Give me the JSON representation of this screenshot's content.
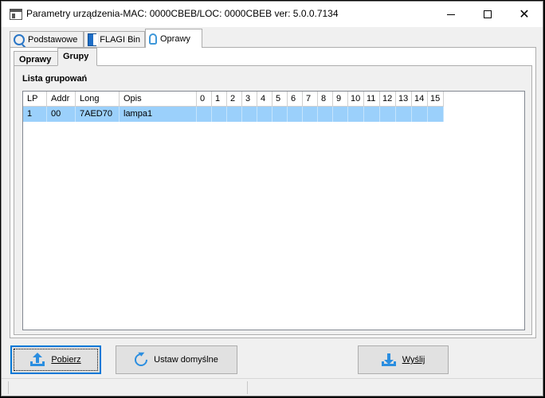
{
  "window": {
    "title": "Parametry urządzenia-MAC: 0000CBEB/LOC: 0000CBEB ver: 5.0.0.7134",
    "controls": [
      "minimize",
      "maximize",
      "close"
    ]
  },
  "outer_tabs": [
    {
      "label": "Podstawowe",
      "icon": "magnifier-icon",
      "active": false
    },
    {
      "label": "FLAGI Bin",
      "icon": "book-icon",
      "active": false
    },
    {
      "label": "Oprawy",
      "icon": "bulb-icon",
      "active": true
    }
  ],
  "inner_tabs": [
    {
      "label": "Oprawy",
      "active": false
    },
    {
      "label": "Grupy",
      "active": true
    }
  ],
  "section": {
    "title": "Lista grupowań"
  },
  "table": {
    "columns": [
      "LP",
      "Addr",
      "Long",
      "Opis",
      "0",
      "1",
      "2",
      "3",
      "4",
      "5",
      "6",
      "7",
      "8",
      "9",
      "10",
      "11",
      "12",
      "13",
      "14",
      "15"
    ],
    "rows": [
      [
        "1",
        "00",
        "7AED70",
        "lampa1",
        "",
        "",
        "",
        "",
        "",
        "",
        "",
        "",
        "",
        "",
        "",
        "",
        "",
        "",
        "",
        ""
      ]
    ],
    "selected_row": 0
  },
  "buttons": {
    "download": "Pobierz",
    "defaults": "Ustaw domyślne",
    "send": "Wyślij"
  },
  "colors": {
    "selection": "#9bd0fb",
    "accent": "#2b8ee0",
    "focus": "#0078d7"
  }
}
